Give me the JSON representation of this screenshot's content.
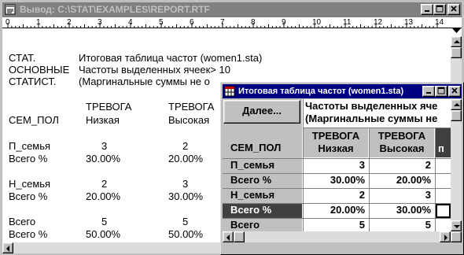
{
  "main_window": {
    "title": "Вывод: C:\\STAT\\EXAMPLES\\REPORT.RTF",
    "ruler_numbers": [
      "0",
      "1",
      "2",
      "3",
      "4",
      "5",
      "6",
      "7",
      "8",
      "9",
      "10",
      "11",
      "12",
      "13",
      "14"
    ]
  },
  "document": {
    "header_labels": [
      "СТАТ.",
      "ОСНОВНЫЕ",
      "СТАТИСТ."
    ],
    "header_values": [
      "Итоговая таблица частот (women1.sta)",
      "Частоты выделенных ячеек> 10",
      "(Маргинальные суммы не о"
    ],
    "col1_top": "ТРЕВОГА",
    "col1_bottom": "Низкая",
    "col2_top": "ТРЕВОГА",
    "col2_bottom": "Высокая",
    "row_header": "СЕМ_ПОЛ",
    "rows": [
      {
        "label": "П_семья",
        "v1": "3",
        "v2": "2"
      },
      {
        "label": "Всего %",
        "v1": "30.00%",
        "v2": "20.00%"
      },
      {
        "label": "Н_семья",
        "v1": "2",
        "v2": "3"
      },
      {
        "label": "Всего %",
        "v1": "20.00%",
        "v2": "30.00%"
      },
      {
        "label": "Всего",
        "v1": "5",
        "v2": "5"
      },
      {
        "label": "Всего %",
        "v1": "50.00%",
        "v2": "50.00%"
      }
    ]
  },
  "child_window": {
    "title": "Итоговая таблица частот (women1.sta)",
    "next_button": "Далее...",
    "header_line1": "Частоты выделенных яче",
    "header_line2": "(Маргинальные суммы не",
    "row_header": "СЕМ_ПОЛ",
    "col1_top": "ТРЕВОГА",
    "col1_bottom": "Низкая",
    "col2_top": "ТРЕВОГА",
    "col2_bottom": "Высокая",
    "col3_partial": "п",
    "rows": [
      {
        "label": "П_семья",
        "v1": "3",
        "v2": "2"
      },
      {
        "label": "Всего %",
        "v1": "30.00%",
        "v2": "20.00%"
      },
      {
        "label": "Н_семья",
        "v1": "2",
        "v2": "3"
      },
      {
        "label": "Всего %",
        "v1": "20.00%",
        "v2": "30.00%"
      },
      {
        "label": "Всего",
        "v1": "5",
        "v2": "5"
      }
    ],
    "selected_row": 3
  },
  "colors": {
    "active_title": "#000080",
    "inactive_title": "#808080",
    "face": "#c0c0c0",
    "selected_row": "#404040"
  }
}
